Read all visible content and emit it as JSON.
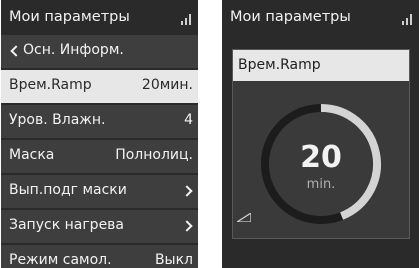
{
  "left_screen": {
    "title": "Мои параметры",
    "back_label": "Осн. Информ.",
    "items": [
      {
        "label": "Врем.Ramp",
        "value": "20мин."
      },
      {
        "label": "Уров. Влажн.",
        "value": "4"
      },
      {
        "label": "Маска",
        "value": "Полнолиц."
      },
      {
        "label": "Вып.подг маски",
        "value": ""
      },
      {
        "label": "Запуск нагрева",
        "value": ""
      },
      {
        "label": "Режим самол.",
        "value": "Выкл"
      }
    ]
  },
  "right_screen": {
    "title": "Мои параметры",
    "panel_title": "Врем.Ramp",
    "value": "20",
    "unit": "min.",
    "dial_fraction": 0.44
  },
  "icons": [
    "signal-icon",
    "back-chevron-icon",
    "chevron-right-icon",
    "ramp-icon"
  ],
  "colors": {
    "screen_bg": "#2a2a2a",
    "item_bg": "#3e3e3e",
    "selected_bg": "#e7e7e7",
    "text": "#f2f2f2"
  }
}
